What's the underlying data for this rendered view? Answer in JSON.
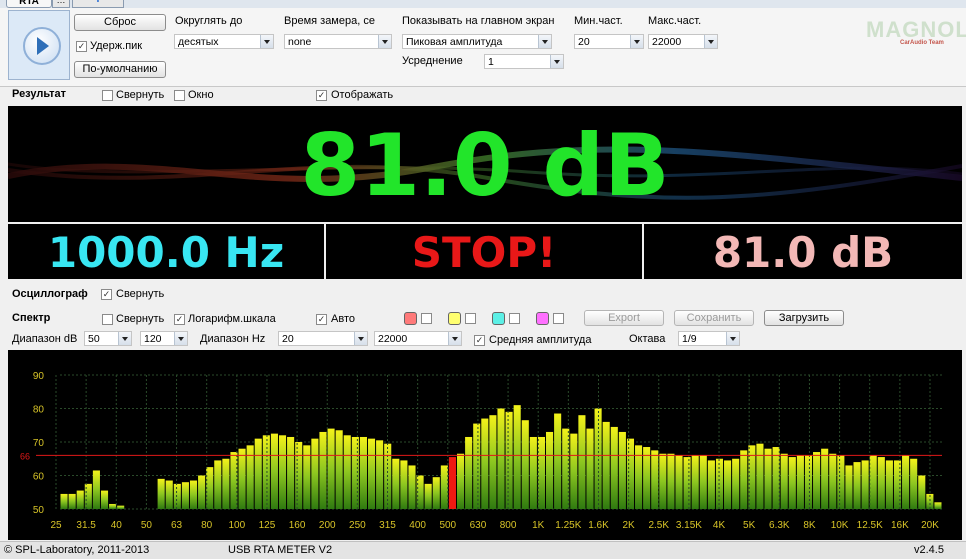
{
  "tabs": {
    "active": "RTA",
    "plus": "+"
  },
  "controls": {
    "reset_label": "Сброс",
    "hold_peak_label": "Удерж.пик",
    "hold_peak_checked": true,
    "default_label": "По-умолчанию",
    "round_label": "Округлять до",
    "round_value": "десятых",
    "measure_time_label": "Время замера, се",
    "measure_time_value": "none",
    "show_main_label": "Показывать на главном экран",
    "show_main_value": "Пиковая амплитуда",
    "averaging_label": "Усреднение",
    "averaging_value": "1",
    "min_freq_label": "Мин.част.",
    "min_freq_value": "20",
    "max_freq_label": "Макс.част.",
    "max_freq_value": "22000"
  },
  "logo": {
    "text": "MAGNOLA",
    "sub": "CarAudio Team"
  },
  "result": {
    "title": "Результат",
    "collapse_label": "Свернуть",
    "window_label": "Окно",
    "display_label": "Отображать",
    "display_checked": true,
    "main_value": "81.0 dB",
    "frequency": "1000.0 Hz",
    "status": "STOP!",
    "level": "81.0 dB",
    "colors": {
      "main": "#22e52a",
      "frequency": "#38e6f2",
      "status": "#e81818",
      "level": "#f3b8b6"
    }
  },
  "oscillograph": {
    "title": "Осциллограф",
    "collapse_label": "Свернуть",
    "collapse_checked": true
  },
  "spectrum": {
    "title": "Спектр",
    "collapse_label": "Свернуть",
    "log_scale_label": "Логарифм.шкала",
    "log_scale_checked": true,
    "auto_label": "Авто",
    "auto_checked": true,
    "export_label": "Export",
    "save_label": "Сохранить",
    "load_label": "Загрузить",
    "db_range_label": "Диапазон dB",
    "db_min": "50",
    "db_max": "120",
    "hz_range_label": "Диапазон Hz",
    "hz_min": "20",
    "hz_max": "22000",
    "avg_amp_label": "Средняя амплитуда",
    "avg_amp_checked": true,
    "octave_label": "Октава",
    "octave_value": "1/9",
    "swatches": [
      "#ff7a7a",
      "#ffff70",
      "#5cf0e6",
      "#ff70ff"
    ]
  },
  "chart_data": {
    "type": "bar",
    "y_ticks": [
      "90",
      "80",
      "70",
      "60",
      "50"
    ],
    "ylim": [
      50,
      90
    ],
    "x_tick_labels": [
      "25",
      "31.5",
      "40",
      "50",
      "63",
      "80",
      "100",
      "125",
      "160",
      "200",
      "250",
      "315",
      "400",
      "500",
      "630",
      "800",
      "1K",
      "1.25K",
      "1.6K",
      "2K",
      "2.5K",
      "3.15K",
      "4K",
      "5K",
      "6.3K",
      "8K",
      "10K",
      "12.5K",
      "16K",
      "20K"
    ],
    "reference_line": {
      "value": 66,
      "label": "66",
      "color": "#e01818"
    },
    "peak_index": 48,
    "values": [
      54.5,
      54.5,
      55.5,
      57.5,
      61.5,
      55.5,
      51.5,
      51,
      50,
      50,
      50,
      50,
      59,
      58.5,
      57.5,
      58,
      58.5,
      60,
      62.5,
      64.5,
      65,
      67,
      68,
      69,
      71,
      72,
      72.5,
      72,
      71.5,
      70,
      69,
      71,
      73,
      74,
      73.5,
      72,
      71.5,
      71.5,
      71,
      70.5,
      69.5,
      65,
      64.5,
      63,
      60,
      57.5,
      59.5,
      63,
      65.5,
      66.5,
      71.5,
      75.5,
      77,
      78,
      80,
      79,
      81,
      76.5,
      71.5,
      71.5,
      73,
      78.5,
      74,
      72.5,
      78,
      74,
      80,
      76,
      74.5,
      73,
      71,
      69,
      68.5,
      67.5,
      66.5,
      66.5,
      66,
      65.5,
      66,
      66,
      64.5,
      65,
      64.5,
      65,
      67.5,
      69,
      69.5,
      68,
      68.5,
      66.5,
      65.5,
      66,
      66,
      67,
      68,
      66.5,
      66,
      63,
      64,
      64.5,
      66,
      65.5,
      64.5,
      64.5,
      66,
      65,
      60,
      54.5,
      52
    ]
  },
  "status": {
    "copyright": "© SPL-Laboratory, 2011-2013",
    "app_name": "USB RTA METER V2",
    "version": "v2.4.5"
  }
}
